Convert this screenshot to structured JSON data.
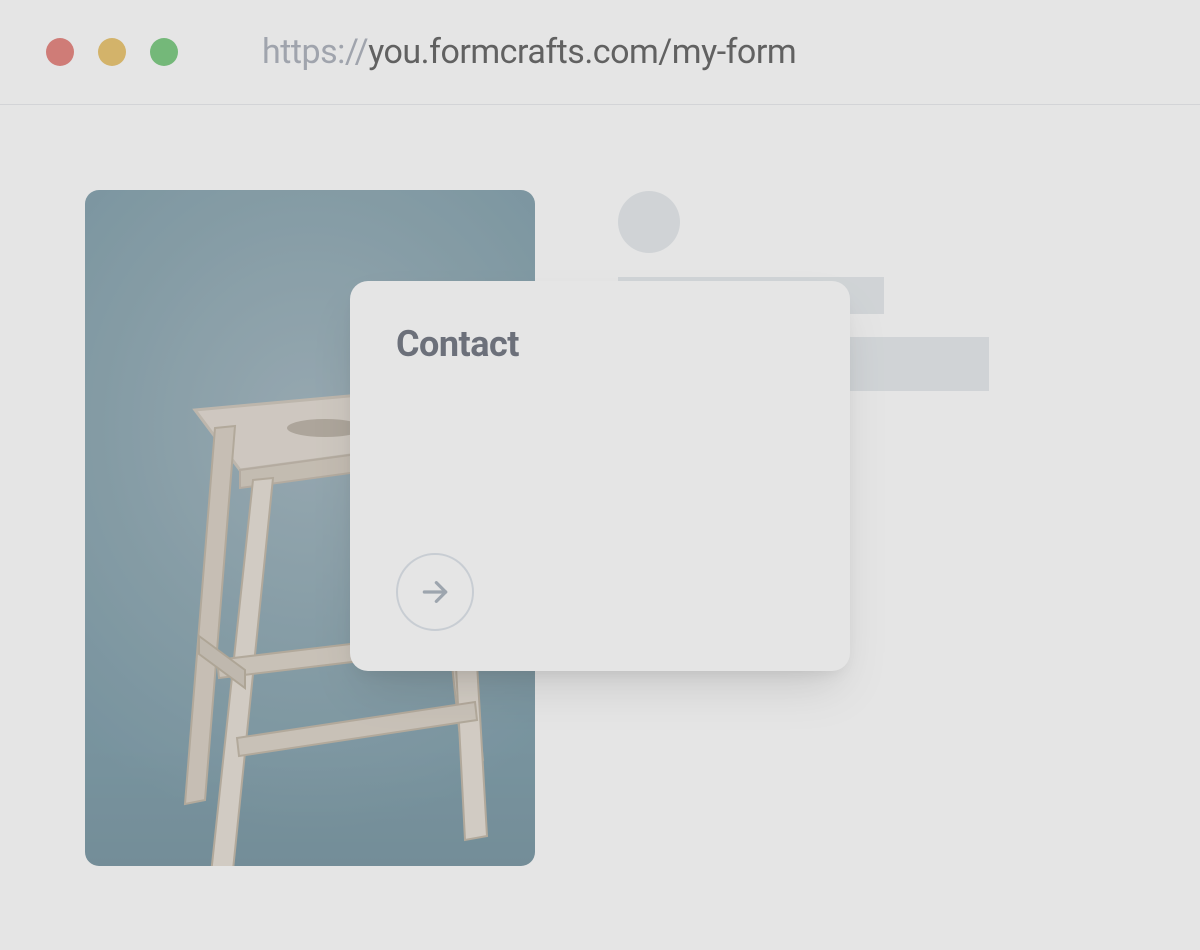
{
  "url": {
    "protocol": "https://",
    "rest": "you.formcrafts.com/my-form"
  },
  "modal": {
    "title": "Contact",
    "next_icon": "arrow-right-icon"
  }
}
